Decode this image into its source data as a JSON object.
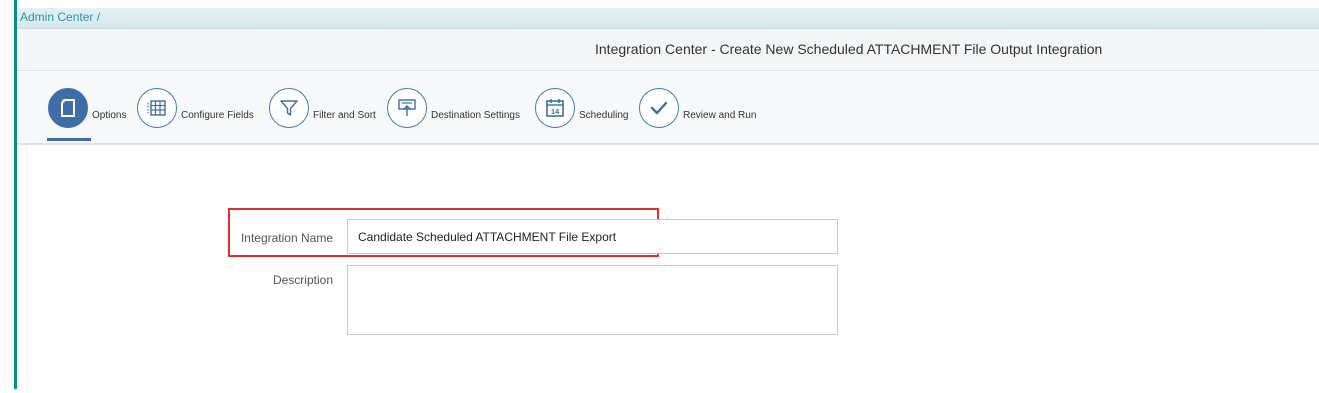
{
  "breadcrumb": {
    "text": "Admin Center /"
  },
  "header": {
    "title": "Integration Center - Create New Scheduled ATTACHMENT File Output Integration"
  },
  "wizard": {
    "steps": [
      {
        "label": "Options",
        "icon": "document-icon",
        "active": true
      },
      {
        "label": "Configure Fields",
        "icon": "grid-icon",
        "active": false
      },
      {
        "label": "Filter and Sort",
        "icon": "filter-icon",
        "active": false
      },
      {
        "label": "Destination Settings",
        "icon": "upload-icon",
        "active": false
      },
      {
        "label": "Scheduling",
        "icon": "calendar-icon",
        "active": false,
        "icon_text": "14"
      },
      {
        "label": "Review and Run",
        "icon": "checkmark-icon",
        "active": false
      }
    ]
  },
  "form": {
    "integration_name": {
      "label": "Integration Name",
      "value": "Candidate Scheduled ATTACHMENT File Export"
    },
    "description": {
      "label": "Description",
      "value": ""
    }
  },
  "colors": {
    "accent": "#3f6da8",
    "highlight": "#e0302b",
    "left_bar": "#0a8a8f"
  }
}
